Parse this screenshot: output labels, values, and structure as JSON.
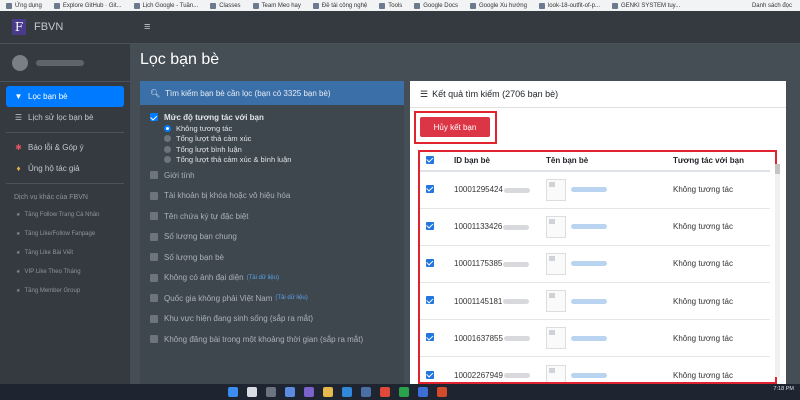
{
  "bookmarks": [
    "Ứng dụng",
    "Explore GitHub · Git...",
    "Lịch Google - Tuần...",
    "Classes",
    "Team Meo hay",
    "Đề tài công nghệ",
    "Tools",
    "Google Docs",
    "Google Xu hướng",
    "look-18-outfit-of-p...",
    "GENKI SYSTEM tuy..."
  ],
  "bookmarks_right": "Danh sách đọc",
  "brand": {
    "name": "FBVN",
    "logo_letter": "F"
  },
  "sidebar": {
    "items": [
      {
        "label": "Lọc bạn bè",
        "icon": "filter-icon",
        "active": true
      },
      {
        "label": "Lịch sử lọc bạn bè",
        "icon": "list-icon",
        "active": false
      }
    ],
    "items2": [
      {
        "label": "Báo lỗi & Góp ý",
        "icon": "bug-icon"
      },
      {
        "label": "Ủng hộ tác giả",
        "icon": "gift-icon"
      }
    ],
    "other_header": "Dịch vụ khác của FBVN",
    "services": [
      "Tăng Follow Trang Cá Nhân",
      "Tăng Like/Follow Fanpage",
      "Tăng Like Bài Viết",
      "VIP Like Theo Tháng",
      "Tăng Member Group"
    ]
  },
  "topbar": {
    "menu_icon": "≡"
  },
  "page": {
    "title": "Lọc bạn bè"
  },
  "filter": {
    "header": "Tìm kiếm bạn bè cần lọc (bạn có 3325 bạn bè)",
    "options": [
      {
        "label": "Mức độ tương tác với bạn",
        "checked": true
      },
      {
        "label": "Giới tính",
        "checked": false
      },
      {
        "label": "Tài khoản bị khóa hoặc vô hiệu hóa",
        "checked": false
      },
      {
        "label": "Tên chứa ký tự đặc biệt",
        "checked": false
      },
      {
        "label": "Số lượng bạn chung",
        "checked": false
      },
      {
        "label": "Số lượng bạn bè",
        "checked": false
      },
      {
        "label": "Không có ảnh đại diện",
        "checked": false,
        "hint": "(Tải dữ liệu)"
      },
      {
        "label": "Quốc gia không phải Việt Nam",
        "checked": false,
        "hint": "(Tải dữ liệu)"
      },
      {
        "label": "Khu vực hiện đang sinh sống (sắp ra mắt)",
        "checked": false
      },
      {
        "label": "Không đăng bài trong một khoảng thời gian (sắp ra mắt)",
        "checked": false
      }
    ],
    "radios": [
      {
        "label": "Không tương tác",
        "selected": true
      },
      {
        "label": "Tổng lượt thả cảm xúc",
        "selected": false
      },
      {
        "label": "Tổng lượt bình luận",
        "selected": false
      },
      {
        "label": "Tổng lượt thả cảm xúc & bình luận",
        "selected": false
      }
    ]
  },
  "results": {
    "header": "Kết quả tìm kiếm (2706 bạn bè)",
    "unfriend_label": "Hủy kết bạn",
    "columns": [
      "ID bạn bè",
      "Tên bạn bè",
      "Tương tác với bạn"
    ],
    "rows": [
      {
        "id": "10001295424",
        "interaction": "Không tương tác"
      },
      {
        "id": "10001133426",
        "interaction": "Không tương tác"
      },
      {
        "id": "10001175385",
        "interaction": "Không tương tác"
      },
      {
        "id": "10001145181",
        "interaction": "Không tương tác"
      },
      {
        "id": "10001637855",
        "interaction": "Không tương tác"
      },
      {
        "id": "10002267949",
        "interaction": "Không tương tác"
      }
    ]
  },
  "taskbar": {
    "time": "7:18 PM"
  },
  "colors": {
    "accent": "#007bff",
    "danger": "#dc3545",
    "highlight": "#e1222f",
    "sidebar": "#343a40"
  }
}
